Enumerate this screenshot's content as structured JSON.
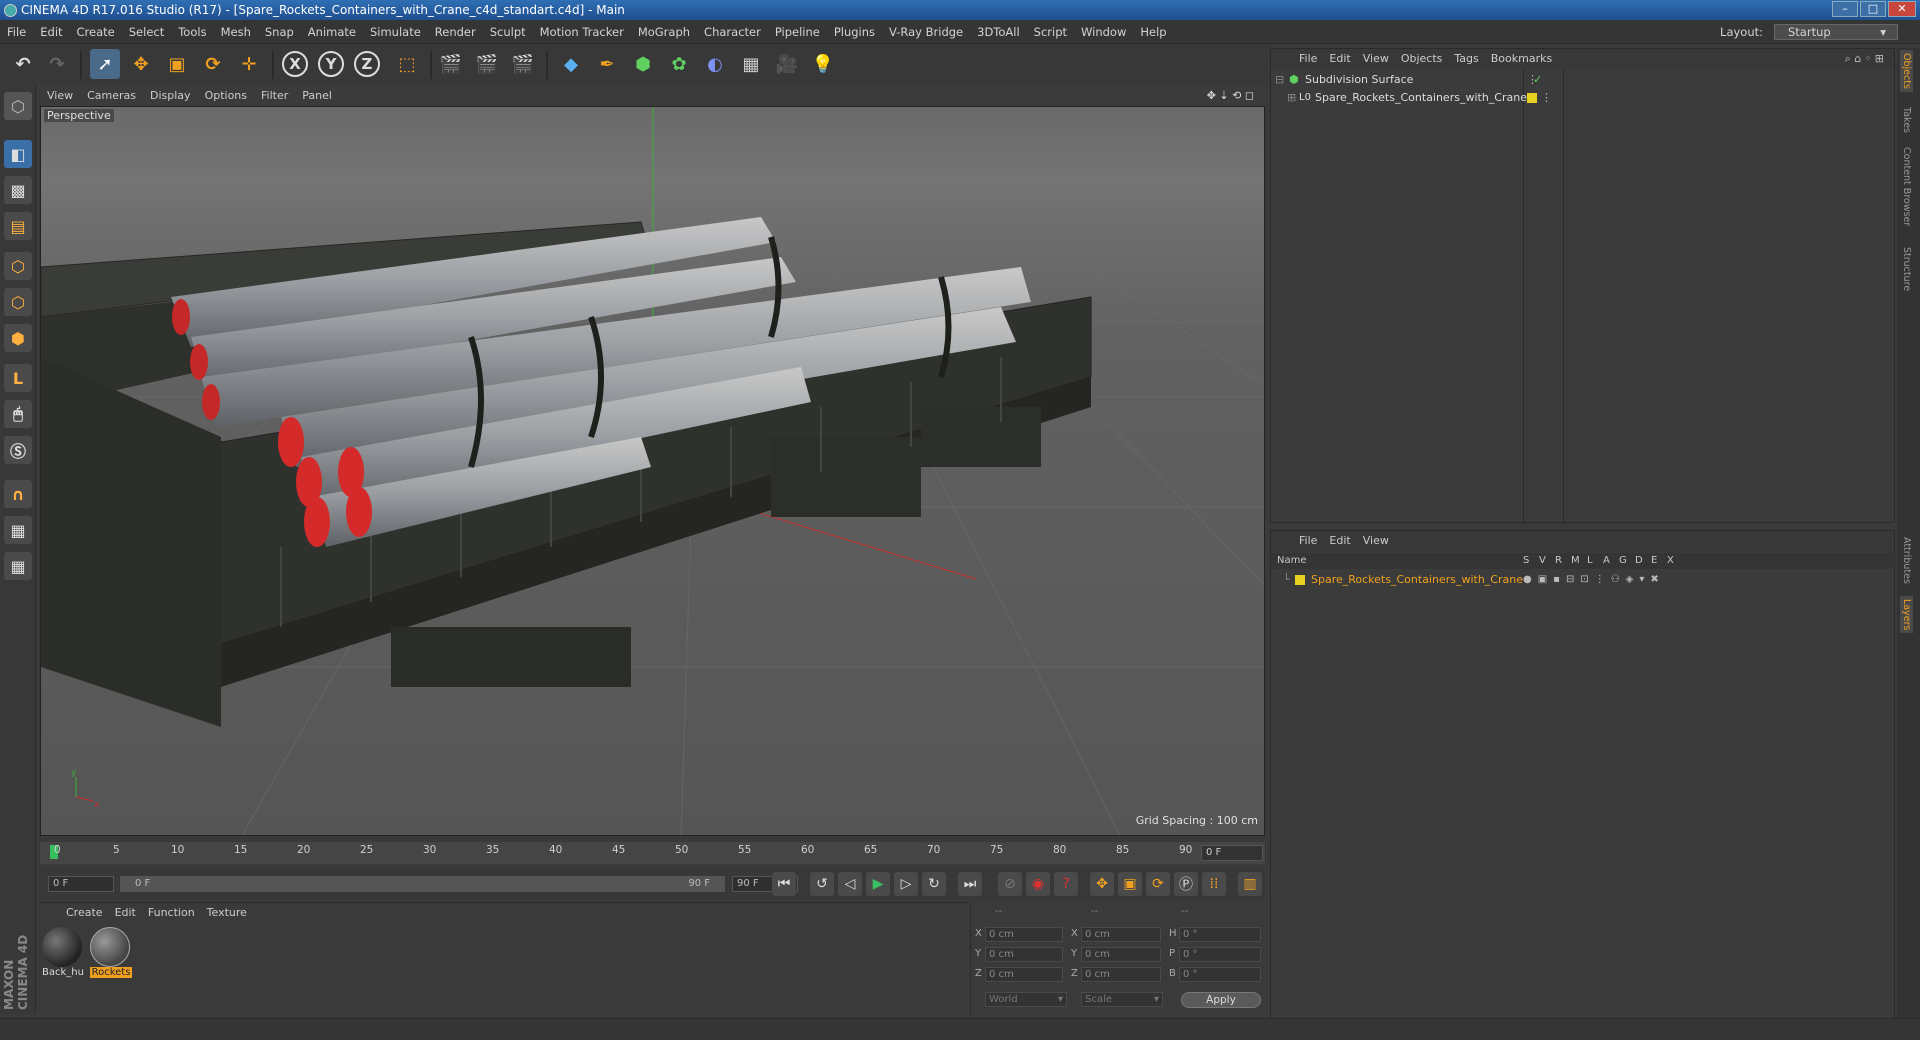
{
  "window": {
    "title": "CINEMA 4D R17.016 Studio (R17) - [Spare_Rockets_Containers_with_Crane_c4d_standart.c4d] - Main"
  },
  "menubar": {
    "items": [
      "File",
      "Edit",
      "Create",
      "Select",
      "Tools",
      "Mesh",
      "Snap",
      "Animate",
      "Simulate",
      "Render",
      "Sculpt",
      "Motion Tracker",
      "MoGraph",
      "Character",
      "Pipeline",
      "Plugins",
      "V-Ray Bridge",
      "3DToAll",
      "Script",
      "Window",
      "Help"
    ],
    "layout_label": "Layout:",
    "layout_value": "Startup"
  },
  "toolbar": {
    "axis_x": "X",
    "axis_y": "Y",
    "axis_z": "Z"
  },
  "viewport": {
    "menu": [
      "View",
      "Cameras",
      "Display",
      "Options",
      "Filter",
      "Panel"
    ],
    "label": "Perspective",
    "grid_spacing": "Grid Spacing : 100 cm"
  },
  "timeline": {
    "ticks": [
      "0",
      "5",
      "10",
      "15",
      "20",
      "25",
      "30",
      "35",
      "40",
      "45",
      "50",
      "55",
      "60",
      "65",
      "70",
      "75",
      "80",
      "85",
      "90"
    ],
    "frame_end": "0 F"
  },
  "transport": {
    "start_field": "0 F",
    "range_start": "0 F",
    "range_end": "90 F",
    "end_field": "90 F"
  },
  "materials": {
    "menu": [
      "Create",
      "Edit",
      "Function",
      "Texture"
    ],
    "items": [
      {
        "name": "Back_hu"
      },
      {
        "name": "Rockets"
      }
    ]
  },
  "coordinates": {
    "headers": [
      "--",
      "--",
      "--"
    ],
    "rows": [
      {
        "a": "X",
        "av": "0 cm",
        "b": "X",
        "bv": "0 cm",
        "c": "H",
        "cv": "0 °"
      },
      {
        "a": "Y",
        "av": "0 cm",
        "b": "Y",
        "bv": "0 cm",
        "c": "P",
        "cv": "0 °"
      },
      {
        "a": "Z",
        "av": "0 cm",
        "b": "Z",
        "bv": "0 cm",
        "c": "B",
        "cv": "0 °"
      }
    ],
    "world": "World",
    "scale": "Scale",
    "apply": "Apply"
  },
  "objects_panel": {
    "menu": [
      "File",
      "Edit",
      "View",
      "Objects",
      "Tags",
      "Bookmarks"
    ],
    "items": [
      {
        "name": "Subdivision Surface"
      },
      {
        "name": "Spare_Rockets_Containers_with_Crane"
      }
    ]
  },
  "layers_panel": {
    "menu": [
      "File",
      "Edit",
      "View"
    ],
    "columns": [
      "Name",
      "S",
      "V",
      "R",
      "M",
      "L",
      "A",
      "G",
      "D",
      "E",
      "X"
    ],
    "items": [
      {
        "name": "Spare_Rockets_Containers_with_Crane"
      }
    ]
  },
  "right_tabs": [
    "Objects",
    "Takes",
    "Content Browser",
    "Structure",
    "Attributes",
    "Layers"
  ],
  "branding": "MAXON CINEMA 4D",
  "colors": {
    "accent_orange": "#f0a020",
    "layer_yellow": "#e8d020",
    "active_blue": "#3a7fd0"
  }
}
